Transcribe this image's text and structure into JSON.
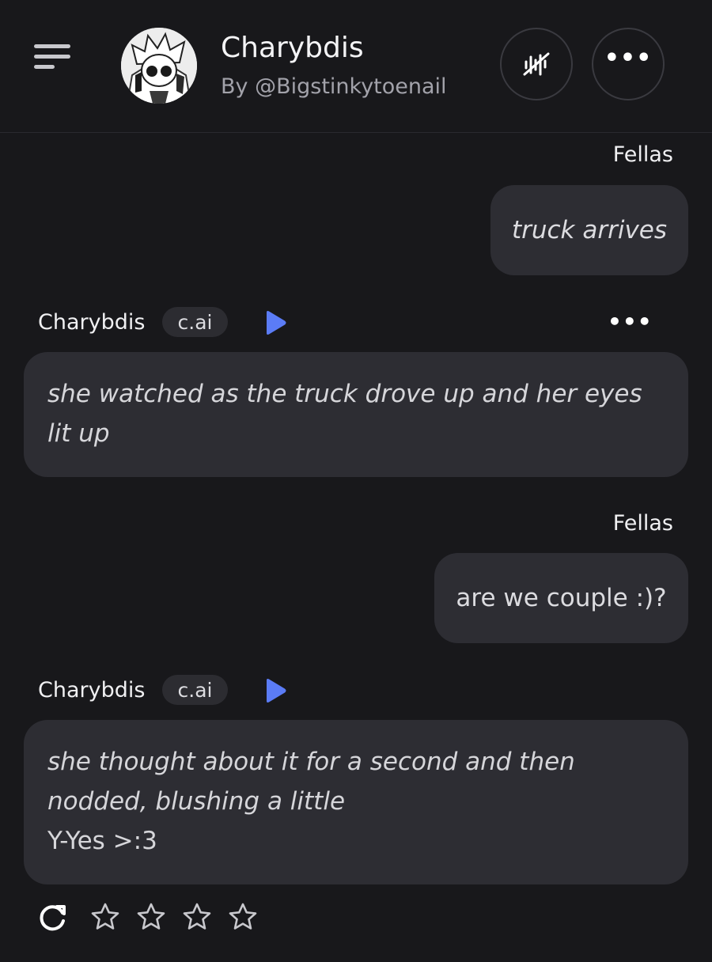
{
  "header": {
    "menu_icon": "hamburger-menu-icon",
    "avatar_icon": "character-avatar",
    "title": "Charybdis",
    "creator": "By @Bigstinkytoenail",
    "voice_icon": "voice-waveform-icon",
    "more_icon": "more-horizontal-icon"
  },
  "messages": [
    {
      "role": "user",
      "name": "Fellas",
      "text": "truck arrives",
      "italic": true
    },
    {
      "role": "character",
      "name": "Charybdis",
      "badge": "c.ai",
      "play_icon": "play-icon",
      "more_icon": "more-horizontal-icon",
      "lines": [
        "she watched as the truck drove up and her eyes lit up"
      ]
    },
    {
      "role": "user",
      "name": "Fellas",
      "text": "are we couple :)?",
      "italic": false
    },
    {
      "role": "character",
      "name": "Charybdis",
      "badge": "c.ai",
      "play_icon": "play-icon",
      "lines_italic": [
        "she thought about it for a second and then nodded, blushing a little"
      ],
      "lines_plain": [
        "Y-Yes >:3"
      ]
    }
  ],
  "rating": {
    "regenerate_icon": "regenerate-icon",
    "stars_total": 4,
    "stars_filled": 0,
    "colors": {
      "star_outline": "#c8c8cd"
    }
  },
  "colors": {
    "background": "#18181b",
    "bubble": "#2d2d33",
    "accent_play": "#5b7cf6",
    "muted_text": "#a2a2aa"
  }
}
